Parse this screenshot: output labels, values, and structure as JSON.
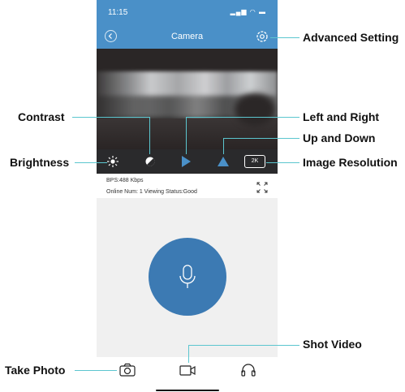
{
  "status_bar": {
    "time": "11:15",
    "icons": "▂▄▆ ◠ ▬"
  },
  "nav": {
    "back_icon": "chevron-left-icon",
    "title": "Camera",
    "settings_icon": "gear-icon"
  },
  "stream": {
    "bps": "BPS:488 Kbps",
    "status": "Online Num: 1  Viewing Status:Good"
  },
  "controls": {
    "brightness_icon": "brightness-icon",
    "contrast_icon": "contrast-icon",
    "left_right_icon": "left-right-flip-icon",
    "up_down_icon": "up-down-flip-icon",
    "resolution": "2K"
  },
  "talk": {
    "mic_icon": "microphone-icon"
  },
  "bottom_bar": {
    "take_photo_icon": "camera-icon",
    "shot_video_icon": "video-camera-icon",
    "listen_icon": "headphones-icon"
  },
  "callouts": {
    "advanced_setting": "Advanced Setting",
    "contrast": "Contrast",
    "left_and_right": "Left and Right",
    "up_and_down": "Up and Down",
    "brightness": "Brightness",
    "image_resolution": "Image Resolution",
    "shot_video": "Shot Video",
    "take_photo": "Take Photo"
  },
  "colors": {
    "header_blue": "#4a90c8",
    "mic_blue": "#3c7ab3",
    "controls_dark": "#2a2a2c",
    "callout_line": "#5cc6cf"
  }
}
